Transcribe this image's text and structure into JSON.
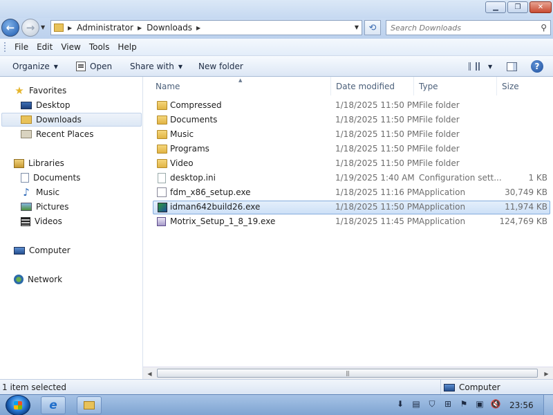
{
  "address": {
    "crumbs": [
      "Administrator",
      "Downloads"
    ]
  },
  "search": {
    "placeholder": "Search Downloads"
  },
  "menu": {
    "items": [
      "File",
      "Edit",
      "View",
      "Tools",
      "Help"
    ]
  },
  "toolbar": {
    "organize": "Organize",
    "open": "Open",
    "share_with": "Share with",
    "new_folder": "New folder"
  },
  "nav": {
    "favorites": "Favorites",
    "desktop": "Desktop",
    "downloads": "Downloads",
    "recent_places": "Recent Places",
    "libraries": "Libraries",
    "documents": "Documents",
    "music": "Music",
    "pictures": "Pictures",
    "videos": "Videos",
    "computer": "Computer",
    "network": "Network"
  },
  "columns": {
    "name": "Name",
    "date_modified": "Date modified",
    "type": "Type",
    "size": "Size"
  },
  "files": [
    {
      "name": "Compressed",
      "date": "1/18/2025 11:50 PM",
      "type": "File folder",
      "size": "",
      "icon": "folder-icon"
    },
    {
      "name": "Documents",
      "date": "1/18/2025 11:50 PM",
      "type": "File folder",
      "size": "",
      "icon": "folder-icon"
    },
    {
      "name": "Music",
      "date": "1/18/2025 11:50 PM",
      "type": "File folder",
      "size": "",
      "icon": "folder-icon"
    },
    {
      "name": "Programs",
      "date": "1/18/2025 11:50 PM",
      "type": "File folder",
      "size": "",
      "icon": "folder-icon"
    },
    {
      "name": "Video",
      "date": "1/18/2025 11:50 PM",
      "type": "File folder",
      "size": "",
      "icon": "folder-icon"
    },
    {
      "name": "desktop.ini",
      "date": "1/19/2025 1:40 AM",
      "type": "Configuration sett...",
      "size": "1 KB",
      "icon": "ini-file-icon"
    },
    {
      "name": "fdm_x86_setup.exe",
      "date": "1/18/2025 11:16 PM",
      "type": "Application",
      "size": "30,749 KB",
      "icon": "installer-icon"
    },
    {
      "name": "idman642build26.exe",
      "date": "1/18/2025 11:50 PM",
      "type": "Application",
      "size": "11,974 KB",
      "icon": "idm-app-icon",
      "selected": true
    },
    {
      "name": "Motrix_Setup_1_8_19.exe",
      "date": "1/18/2025 11:45 PM",
      "type": "Application",
      "size": "124,769 KB",
      "icon": "motrix-app-icon"
    }
  ],
  "status": {
    "selection": "1 item selected",
    "location": "Computer"
  },
  "taskbar": {
    "clock": "23:56"
  }
}
